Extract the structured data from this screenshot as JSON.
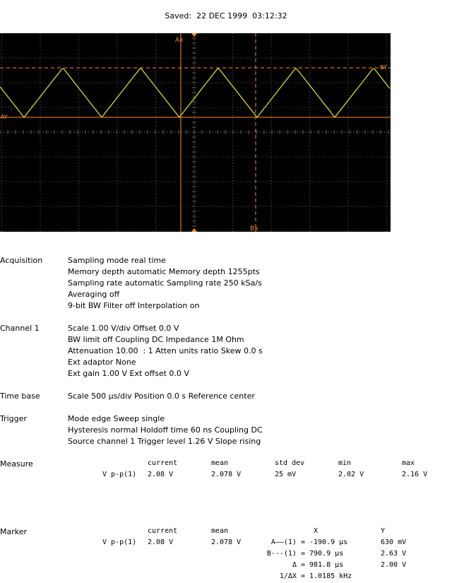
{
  "saved": "Saved:  22 DEC 1999  03:12:32",
  "scope": {
    "colors": {
      "background": "#000000",
      "grid": "#5a5a5a",
      "trace": "#e8e830",
      "marker": "#ff9020"
    },
    "marker_labels": {
      "ax": "Ax",
      "bx": "Bx",
      "ay": "AY",
      "by": "BY"
    }
  },
  "acquisition": {
    "label": "Acquisition",
    "lines": [
      "Sampling mode real time",
      "Memory depth automatic Memory depth 1255pts",
      "Sampling rate automatic Sampling rate 250 kSa/s",
      "Averaging off",
      "9-bit BW Filter off Interpolation on"
    ]
  },
  "channel1": {
    "label": "Channel 1",
    "lines": [
      "Scale 1.00 V/div Offset 0.0 V",
      "BW limit off Coupling DC Impedance 1M Ohm",
      "Attenuation 10.00  : 1 Atten units ratio Skew 0.0 s",
      "Ext adaptor None",
      "Ext gain 1.00 V Ext offset 0.0 V"
    ]
  },
  "timebase": {
    "label": "Time base",
    "lines": [
      "Scale 500 µs/div Position 0.0 s Reference center"
    ]
  },
  "trigger": {
    "label": "Trigger",
    "lines": [
      "Mode edge Sweep single",
      "Hysteresis normal Holdoff time 60 ns Coupling DC",
      "Source channel 1 Trigger level 1.26 V Slope rising"
    ]
  },
  "measure": {
    "label": "Measure",
    "headers": [
      "current",
      "mean",
      "std dev",
      "min",
      "max"
    ],
    "row": {
      "name": "V p-p(1)",
      "current": "2.08 V",
      "mean": "2.078 V",
      "std_dev": "25 mV",
      "min": "2.02 V",
      "max": "2.16 V"
    }
  },
  "marker": {
    "label": "Marker",
    "headers": [
      "current",
      "mean",
      "X",
      "Y"
    ],
    "row": {
      "name": "V p-p(1)",
      "current": "2.08 V",
      "mean": "2.078 V"
    },
    "rows": [
      {
        "label": "A——(1) =",
        "x": "-190.9 µs",
        "y": "630 mV"
      },
      {
        "label": "B---(1) =",
        "x": "790.9 µs",
        "y": "2.63 V"
      },
      {
        "label": "Δ =",
        "x": "981.8 µs",
        "y": "2.00 V"
      },
      {
        "label": "1/ΔX =",
        "x": "1.0185 kHz",
        "y": ""
      }
    ]
  }
}
